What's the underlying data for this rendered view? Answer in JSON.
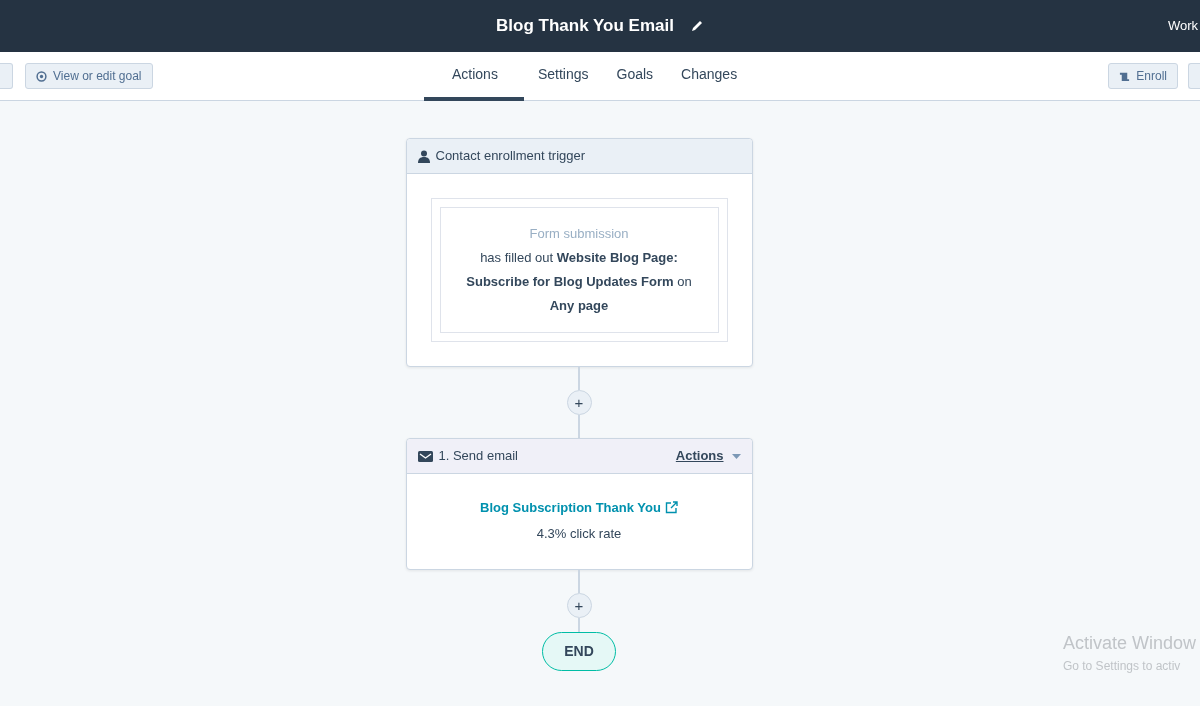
{
  "header": {
    "title": "Blog Thank You Email",
    "right_text": "Work"
  },
  "toolbar": {
    "left_buttons": [
      {
        "label": "View or edit goal"
      }
    ],
    "right_buttons": [
      {
        "label": "Enroll"
      }
    ]
  },
  "tabs": [
    {
      "label": "Actions",
      "selected": true
    },
    {
      "label": "Settings",
      "selected": false
    },
    {
      "label": "Goals",
      "selected": false
    },
    {
      "label": "Changes",
      "selected": false
    }
  ],
  "trigger": {
    "title": "Contact enrollment trigger",
    "filter_type": "Form submission",
    "filter_text": "has filled out **Website Blog Page: Subscribe for Blog Updates Form** on **Any page**"
  },
  "actions": [
    {
      "title": "1. Send email",
      "menu": "Actions",
      "email_link": "Blog Subscription Thank You",
      "stat": "4.3% click rate"
    }
  ],
  "connectors": [
    {
      "label": "+"
    },
    {
      "label": "+"
    }
  ],
  "end_label": "END",
  "os_notice": {
    "title": "Activate Window",
    "subtitle": "Go to Settings to activ"
  }
}
